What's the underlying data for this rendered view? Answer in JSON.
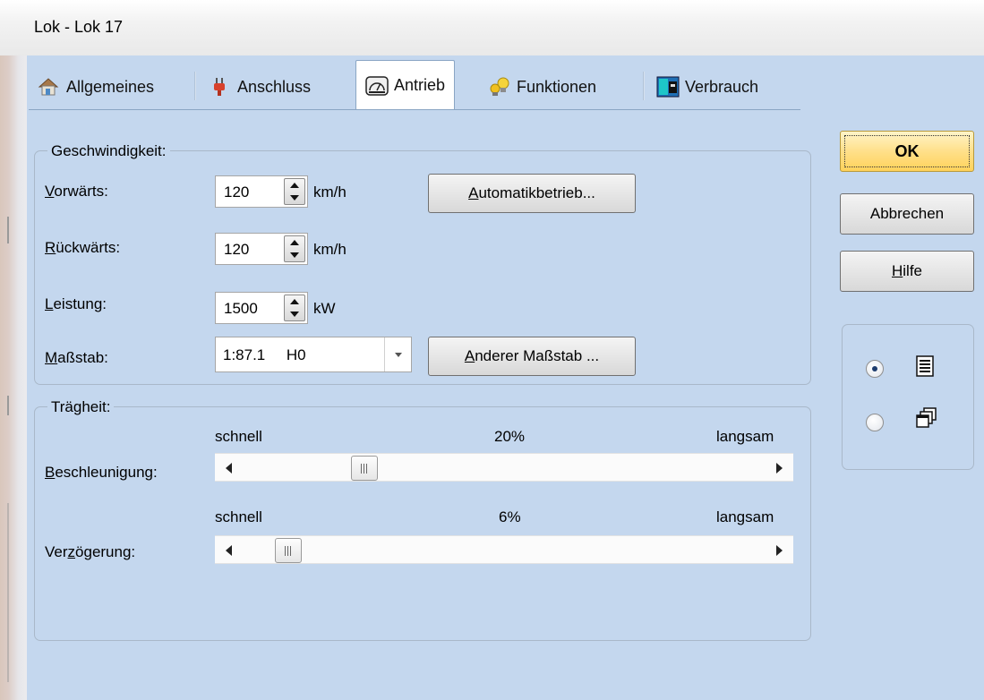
{
  "window": {
    "title": "Lok - Lok 17"
  },
  "tabs": [
    {
      "label": "Allgemeines",
      "icon": "house-icon"
    },
    {
      "label": "Anschluss",
      "icon": "plug-icon"
    },
    {
      "label": "Antrieb",
      "icon": "gauge-icon"
    },
    {
      "label": "Funktionen",
      "icon": "lightbulbs-icon"
    },
    {
      "label": "Verbrauch",
      "icon": "meter-icon"
    }
  ],
  "speed": {
    "legend": "Geschwindigkeit:",
    "forward": {
      "label_ul": "V",
      "label_rest": "orwärts:",
      "value": "120",
      "unit": "km/h"
    },
    "backward": {
      "label_ul": "R",
      "label_rest": "ückwärts:",
      "value": "120",
      "unit": "km/h"
    },
    "power": {
      "label_ul": "L",
      "label_rest": "eistung:",
      "value": "1500",
      "unit": "kW"
    },
    "scale": {
      "label_ul": "M",
      "label_rest": "aßstab:",
      "value": "1:87.1     H0"
    },
    "auto_button": {
      "ul": "A",
      "rest": "utomatikbetrieb..."
    },
    "other_scale_button": {
      "ul": "A",
      "rest": "nderer Maßstab ..."
    }
  },
  "inertia": {
    "legend": "Trägheit:",
    "acceleration": {
      "label_ul": "B",
      "label_rest": "eschleunigung:",
      "left": "schnell",
      "right": "langsam",
      "value_text": "20%",
      "value": 20
    },
    "deceleration": {
      "label_pre": "Ver",
      "label_ul": "z",
      "label_rest": "ögerung:",
      "left": "schnell",
      "right": "langsam",
      "value_text": "6%",
      "value": 6
    }
  },
  "buttons": {
    "ok": "OK",
    "cancel": "Abbrechen",
    "help_ul": "H",
    "help_rest": "ilfe"
  },
  "view": {
    "options": [
      {
        "icon": "list-icon",
        "checked": true
      },
      {
        "icon": "cascade-windows-icon",
        "checked": false
      }
    ]
  },
  "colors": {
    "dialog_bg": "#c4d7ee",
    "ok_button": "#ffe08a"
  }
}
